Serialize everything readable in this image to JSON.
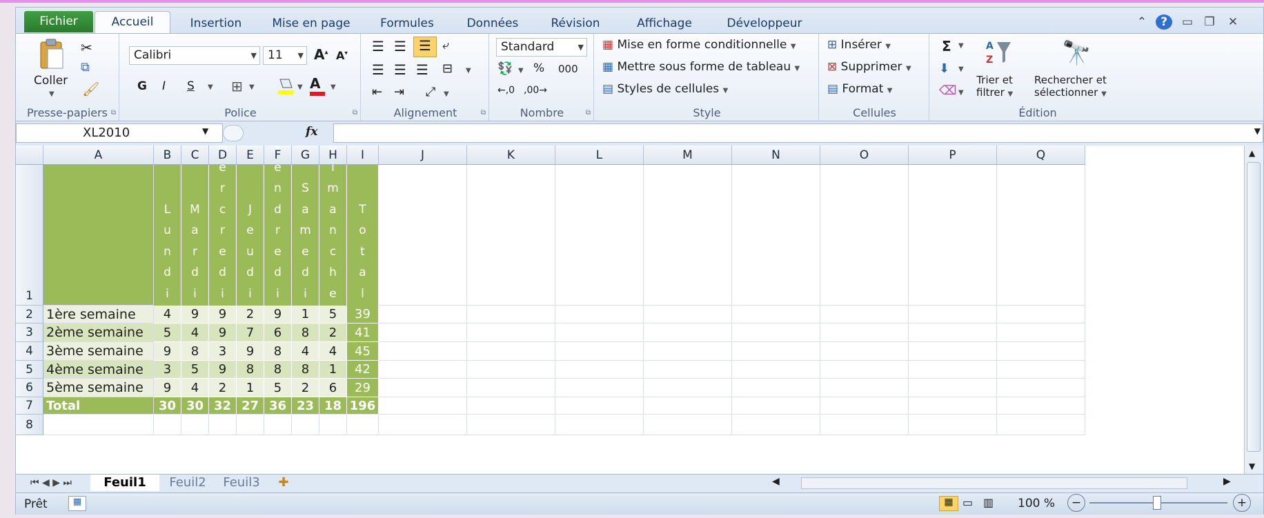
{
  "tabs": {
    "file": "Fichier",
    "home": "Accueil",
    "insert": "Insertion",
    "page_layout": "Mise en page",
    "formulas": "Formules",
    "data": "Données",
    "review": "Révision",
    "view": "Affichage",
    "developer": "Développeur"
  },
  "ribbon": {
    "clipboard": {
      "paste": "Coller",
      "label": "Presse-papiers"
    },
    "font": {
      "name": "Calibri",
      "size": "11",
      "bold": "G",
      "italic": "I",
      "underline": "S",
      "label": "Police"
    },
    "alignment": {
      "label": "Alignement"
    },
    "number": {
      "format": "Standard",
      "percent": "%",
      "thousands": "000",
      "label": "Nombre"
    },
    "style": {
      "conditional": "Mise en forme conditionnelle",
      "as_table": "Mettre sous forme de tableau",
      "cell_styles": "Styles de cellules",
      "label": "Style"
    },
    "cells": {
      "insert": "Insérer",
      "delete": "Supprimer",
      "format": "Format",
      "label": "Cellules"
    },
    "editing": {
      "sum": "Σ",
      "sort_filter_1": "Trier et",
      "sort_filter_2": "filtrer",
      "find_1": "Rechercher et",
      "find_2": "sélectionner",
      "label": "Édition"
    }
  },
  "formula_bar": {
    "name_box": "XL2010",
    "fx": "fx",
    "formula": ""
  },
  "columns": [
    "A",
    "B",
    "C",
    "D",
    "E",
    "F",
    "G",
    "H",
    "I",
    "J",
    "K",
    "L",
    "M",
    "N",
    "O",
    "P",
    "Q"
  ],
  "rows": [
    "1",
    "2",
    "3",
    "4",
    "5",
    "6",
    "7",
    "8"
  ],
  "table": {
    "day_headers": [
      "Lundi",
      "Mardi",
      "Mercredi",
      "Jeudi",
      "Vendredi",
      "Samedi",
      "Dimanche",
      "Total"
    ],
    "weeks": [
      {
        "label": "1ère semaine",
        "values": [
          "4",
          "9",
          "9",
          "2",
          "9",
          "1",
          "5",
          "39"
        ]
      },
      {
        "label": "2ème semaine",
        "values": [
          "5",
          "4",
          "9",
          "7",
          "6",
          "8",
          "2",
          "41"
        ]
      },
      {
        "label": "3ème semaine",
        "values": [
          "9",
          "8",
          "3",
          "9",
          "8",
          "4",
          "4",
          "45"
        ]
      },
      {
        "label": "4ème semaine",
        "values": [
          "3",
          "5",
          "9",
          "8",
          "8",
          "8",
          "1",
          "42"
        ]
      },
      {
        "label": "5ème semaine",
        "values": [
          "9",
          "4",
          "2",
          "1",
          "5",
          "2",
          "6",
          "29"
        ]
      }
    ],
    "total_row": {
      "label": "Total",
      "values": [
        "30",
        "30",
        "32",
        "27",
        "36",
        "23",
        "18",
        "196"
      ]
    }
  },
  "sheets": {
    "sheet1": "Feuil1",
    "sheet2": "Feuil2",
    "sheet3": "Feuil3"
  },
  "status": {
    "ready": "Prêt",
    "zoom": "100 %",
    "minus": "−",
    "plus": "+"
  },
  "colors": {
    "green": "#9bbb59",
    "light_green": "#ebf1de",
    "mid_green": "#d8e4bc",
    "file_tab": "#2a7b2e"
  }
}
